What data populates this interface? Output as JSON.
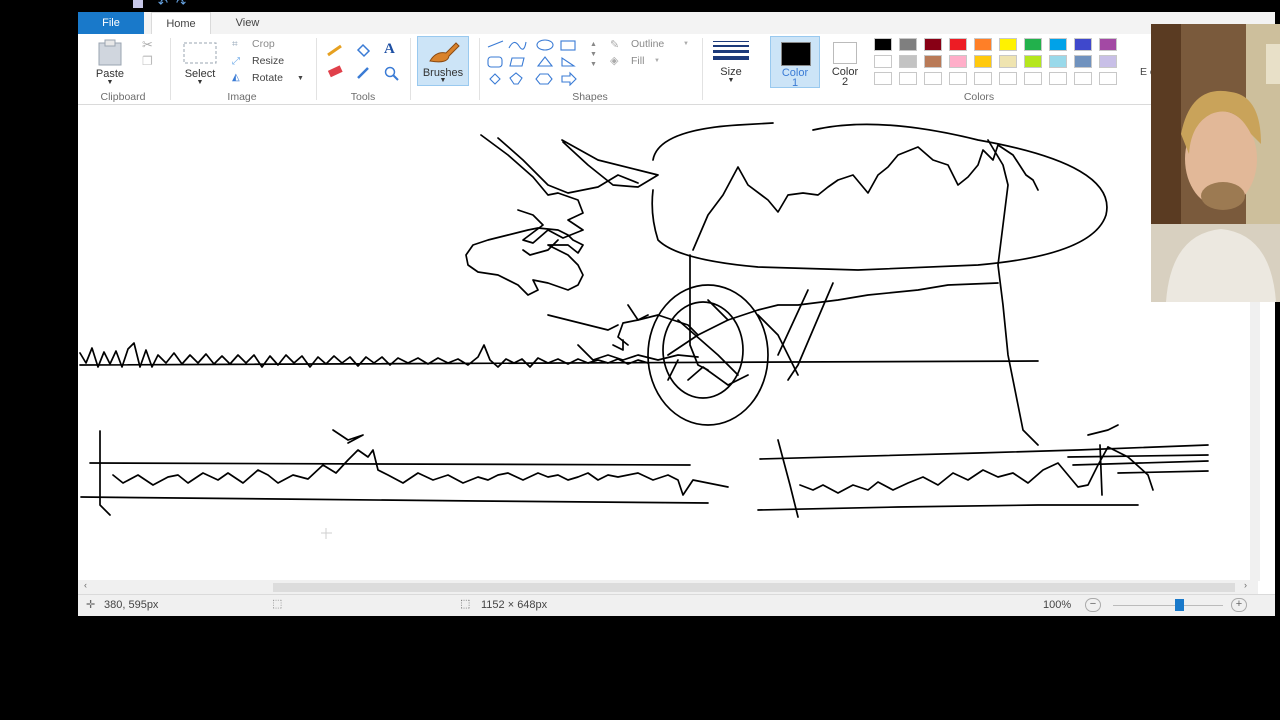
{
  "tabs": {
    "file": "File",
    "home": "Home",
    "view": "View"
  },
  "clipboard": {
    "paste": "Paste",
    "group": "Clipboard"
  },
  "image": {
    "select": "Select",
    "crop": "Crop",
    "resize": "Resize",
    "rotate": "Rotate",
    "group": "Image"
  },
  "tools": {
    "group": "Tools",
    "text_glyph": "A"
  },
  "brushes": {
    "label": "Brushes"
  },
  "shapes": {
    "outline": "Outline",
    "fill": "Fill",
    "group": "Shapes"
  },
  "size": {
    "label": "Size"
  },
  "color1": {
    "label": "Color",
    "num": "1",
    "value": "#000000"
  },
  "color2": {
    "label": "Color",
    "num": "2",
    "value": "#ffffff"
  },
  "colors": {
    "group": "Colors",
    "row1": [
      "#000000",
      "#7f7f7f",
      "#880015",
      "#ed1c24",
      "#ff7f27",
      "#fff200",
      "#22b14c",
      "#00a2e8",
      "#3f48cc",
      "#a349a4"
    ],
    "row2": [
      "#ffffff",
      "#c3c3c3",
      "#b97a57",
      "#ffaec9",
      "#ffc90e",
      "#efe4b0",
      "#b5e61d",
      "#99d9ea",
      "#7092be",
      "#c8bfe7"
    ],
    "edit_label": "E co"
  },
  "status": {
    "cursor_pos": "380, 595px",
    "canvas_size": "1152 × 648px",
    "zoom": "100%",
    "zoom_level": 0.6
  }
}
